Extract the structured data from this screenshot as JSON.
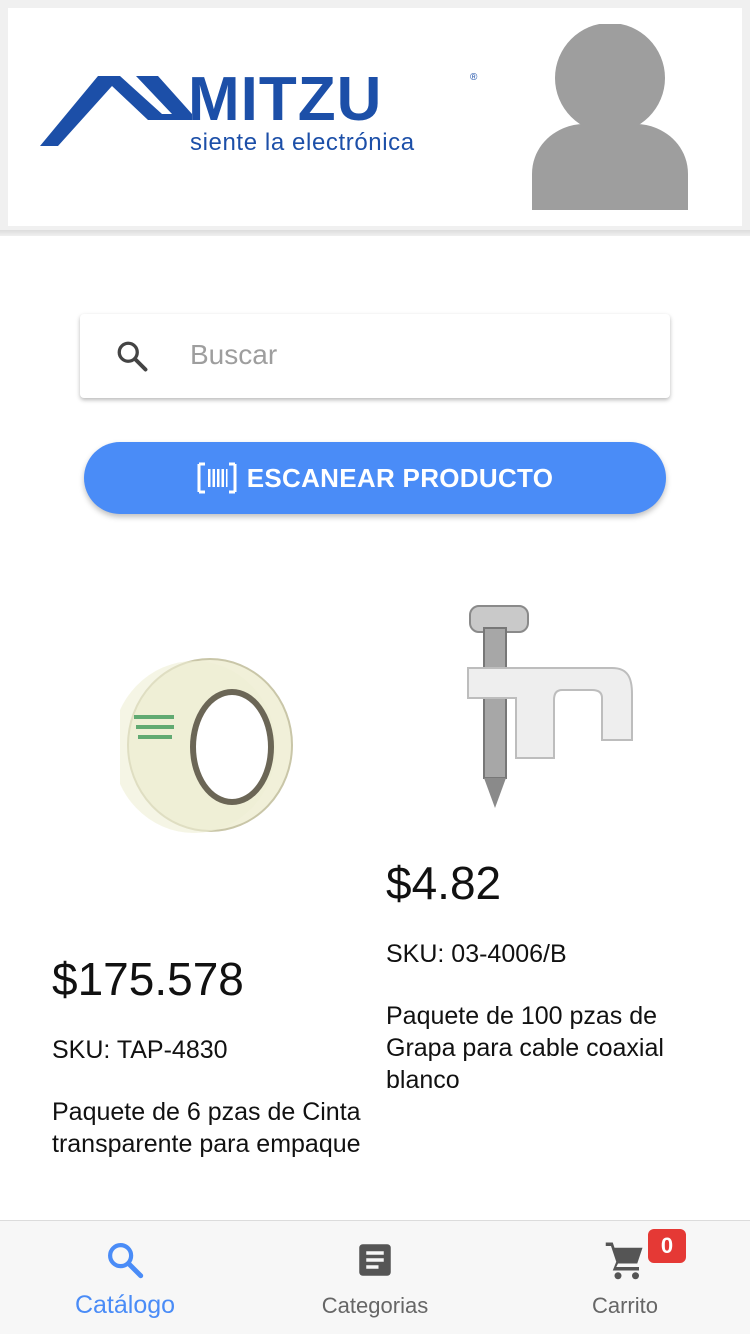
{
  "header": {
    "brand": "MITZU",
    "tagline": "siente la electrónica",
    "avatar_icon": "user-avatar-icon"
  },
  "search": {
    "placeholder": "Buscar",
    "value": "",
    "icon": "search-icon"
  },
  "scan_button": {
    "label": "ESCANEAR PRODUCTO",
    "icon": "barcode-scan-icon"
  },
  "products": [
    {
      "image": "clear-packing-tape-roll",
      "price": "$175.578",
      "sku": "SKU: TAP-4830",
      "description": "Paquete de 6 pzas de Cinta transparente para empaque"
    },
    {
      "image": "white-coaxial-cable-clip",
      "price": "$4.82",
      "sku": "SKU: 03-4006/B",
      "description": "Paquete de 100 pzas de Grapa para cable coaxial blanco"
    }
  ],
  "bottom_nav": {
    "items": [
      {
        "label": "Catálogo",
        "icon": "search-icon",
        "active": true
      },
      {
        "label": "Categorias",
        "icon": "document-list-icon",
        "active": false
      },
      {
        "label": "Carrito",
        "icon": "shopping-cart-icon",
        "active": false
      }
    ],
    "cart_count": "0"
  },
  "colors": {
    "accent": "#4a8cf7",
    "brand_blue": "#1c4fa8",
    "badge_red": "#e53935",
    "icon_gray": "#555555"
  }
}
